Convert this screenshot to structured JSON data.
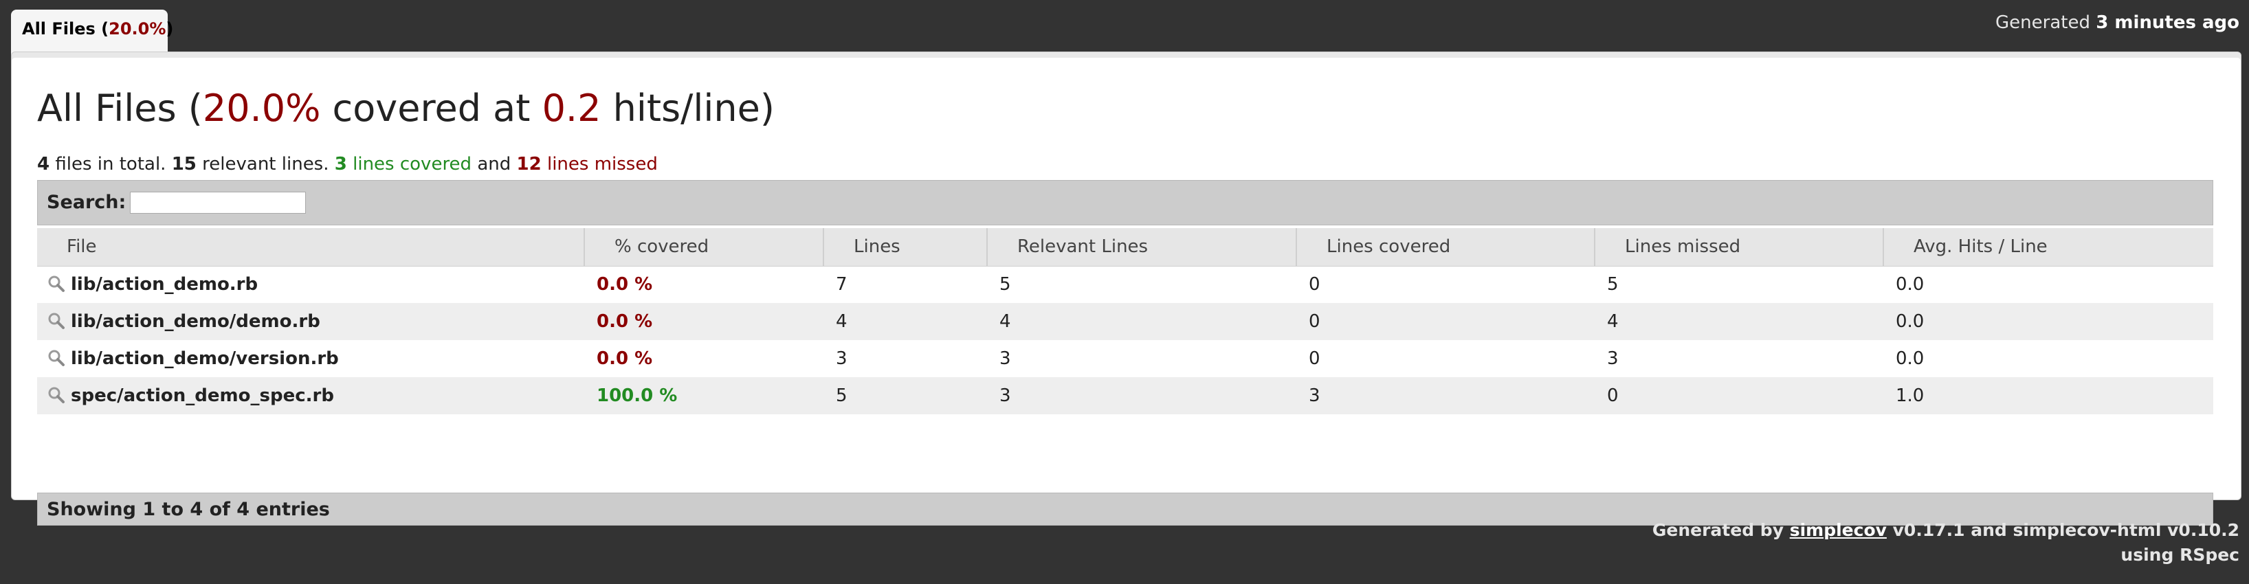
{
  "tab": {
    "label": "All Files",
    "percent": "20.0%"
  },
  "generated_top": {
    "prefix": "Generated",
    "time": "3 minutes ago"
  },
  "header": {
    "title_prefix": "All Files (",
    "percent": "20.0%",
    "middle": " covered at ",
    "hits": "0.2",
    "suffix": " hits/line)"
  },
  "summary": {
    "files_count": "4",
    "files_text": " files in total. ",
    "relevant_count": "15",
    "relevant_text": " relevant lines. ",
    "covered_count": "3",
    "covered_text": " lines covered",
    "and_text": " and ",
    "missed_count": "12",
    "missed_text": " lines missed"
  },
  "search": {
    "label": "Search:",
    "value": ""
  },
  "table": {
    "columns": [
      "File",
      "% covered",
      "Lines",
      "Relevant Lines",
      "Lines covered",
      "Lines missed",
      "Avg. Hits / Line"
    ],
    "rows": [
      {
        "file": "lib/action_demo.rb",
        "covered_pct": "0.0 %",
        "status": "red",
        "lines": "7",
        "relevant": "5",
        "covered": "0",
        "missed": "5",
        "avg": "0.0"
      },
      {
        "file": "lib/action_demo/demo.rb",
        "covered_pct": "0.0 %",
        "status": "red",
        "lines": "4",
        "relevant": "4",
        "covered": "0",
        "missed": "4",
        "avg": "0.0"
      },
      {
        "file": "lib/action_demo/version.rb",
        "covered_pct": "0.0 %",
        "status": "red",
        "lines": "3",
        "relevant": "3",
        "covered": "0",
        "missed": "3",
        "avg": "0.0"
      },
      {
        "file": "spec/action_demo_spec.rb",
        "covered_pct": "100.0 %",
        "status": "green",
        "lines": "5",
        "relevant": "3",
        "covered": "3",
        "missed": "0",
        "avg": "1.0"
      }
    ]
  },
  "info": {
    "text": "Showing 1 to 4 of 4 entries"
  },
  "credits": {
    "prefix": "Generated by ",
    "link": "simplecov",
    "middle": " v0.17.1 and simplecov-html v0.10.2",
    "line2": "using RSpec"
  },
  "colors": {
    "red": "#8b0000",
    "green": "#228b22",
    "background": "#333333"
  },
  "icons": {
    "file_row": "magnifier-icon"
  }
}
